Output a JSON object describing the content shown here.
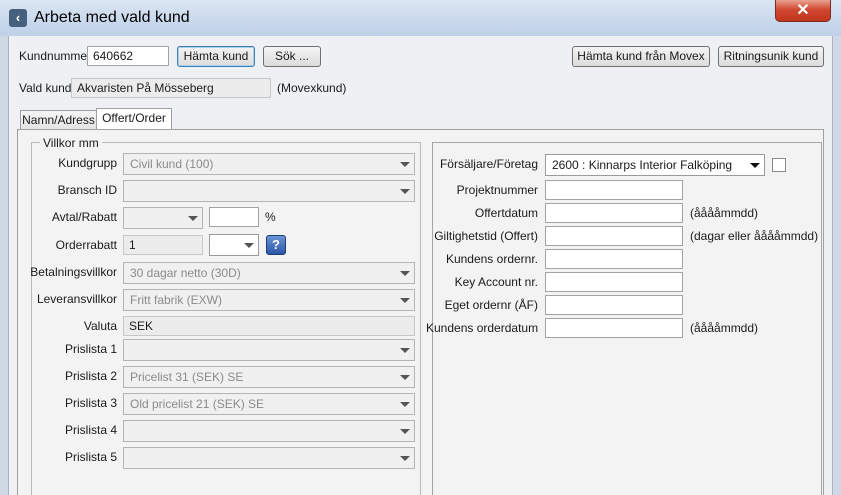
{
  "window": {
    "title": "Arbeta med vald kund",
    "close_glyph": "✕"
  },
  "top": {
    "kundnummer_label": "Kundnummer",
    "kundnummer_value": "640662",
    "hamta_kund": "Hämta kund",
    "sok": "Sök ...",
    "hamta_movex": "Hämta kund från Movex",
    "ritningsunik": "Ritningsunik kund",
    "vald_kund_label": "Vald kund",
    "vald_kund_value": "Akvaristen På Mösseberg",
    "movexkund": "(Movexkund)"
  },
  "tabs": [
    {
      "label": "Namn/Adress",
      "selected": false
    },
    {
      "label": "Offert/Order",
      "selected": true
    }
  ],
  "villkor": {
    "legend": "Villkor mm",
    "kundgrupp_label": "Kundgrupp",
    "kundgrupp_value": "Civil kund  (100)",
    "bransch_label": "Bransch ID",
    "bransch_value": "",
    "avtal_label": "Avtal/Rabatt",
    "avtal_value": "",
    "avtal_pct": "",
    "pct_sign": "%",
    "orderrabatt_label": "Orderrabatt",
    "orderrabatt_value": "1",
    "orderrabatt_combo": "",
    "help_glyph": "?",
    "betalning_label": "Betalningsvillkor",
    "betalning_value": "30 dagar netto  (30D)",
    "leverans_label": "Leveransvillkor",
    "leverans_value": "Fritt fabrik  (EXW)",
    "valuta_label": "Valuta",
    "valuta_value": "SEK",
    "prislista1_label": "Prislista 1",
    "prislista1_value": "",
    "prislista2_label": "Prislista 2",
    "prislista2_value": "Pricelist 31 (SEK) SE",
    "prislista3_label": "Prislista 3",
    "prislista3_value": "Old pricelist 21 (SEK) SE",
    "prislista4_label": "Prislista 4",
    "prislista4_value": "",
    "prislista5_label": "Prislista 5",
    "prislista5_value": ""
  },
  "order": {
    "saljare_label": "Försäljare/Företag",
    "saljare_value": "2600 : Kinnarps Interior Falköping",
    "projektnummer_label": "Projektnummer",
    "projektnummer_value": "",
    "offertdatum_label": "Offertdatum",
    "offertdatum_value": "",
    "offertdatum_hint": "(ååååmmdd)",
    "giltighet_label": "Giltighetstid (Offert)",
    "giltighet_value": "",
    "giltighet_hint": "(dagar eller ååååmmdd)",
    "kundens_ordernr_label": "Kundens ordernr.",
    "kundens_ordernr_value": "",
    "key_account_label": "Key Account nr.",
    "key_account_value": "",
    "eget_ordernr_label": "Eget ordernr (ÅF)",
    "eget_ordernr_value": "",
    "orderdatum_label": "Kundens orderdatum",
    "orderdatum_value": "",
    "orderdatum_hint": "(ååååmmdd)"
  }
}
